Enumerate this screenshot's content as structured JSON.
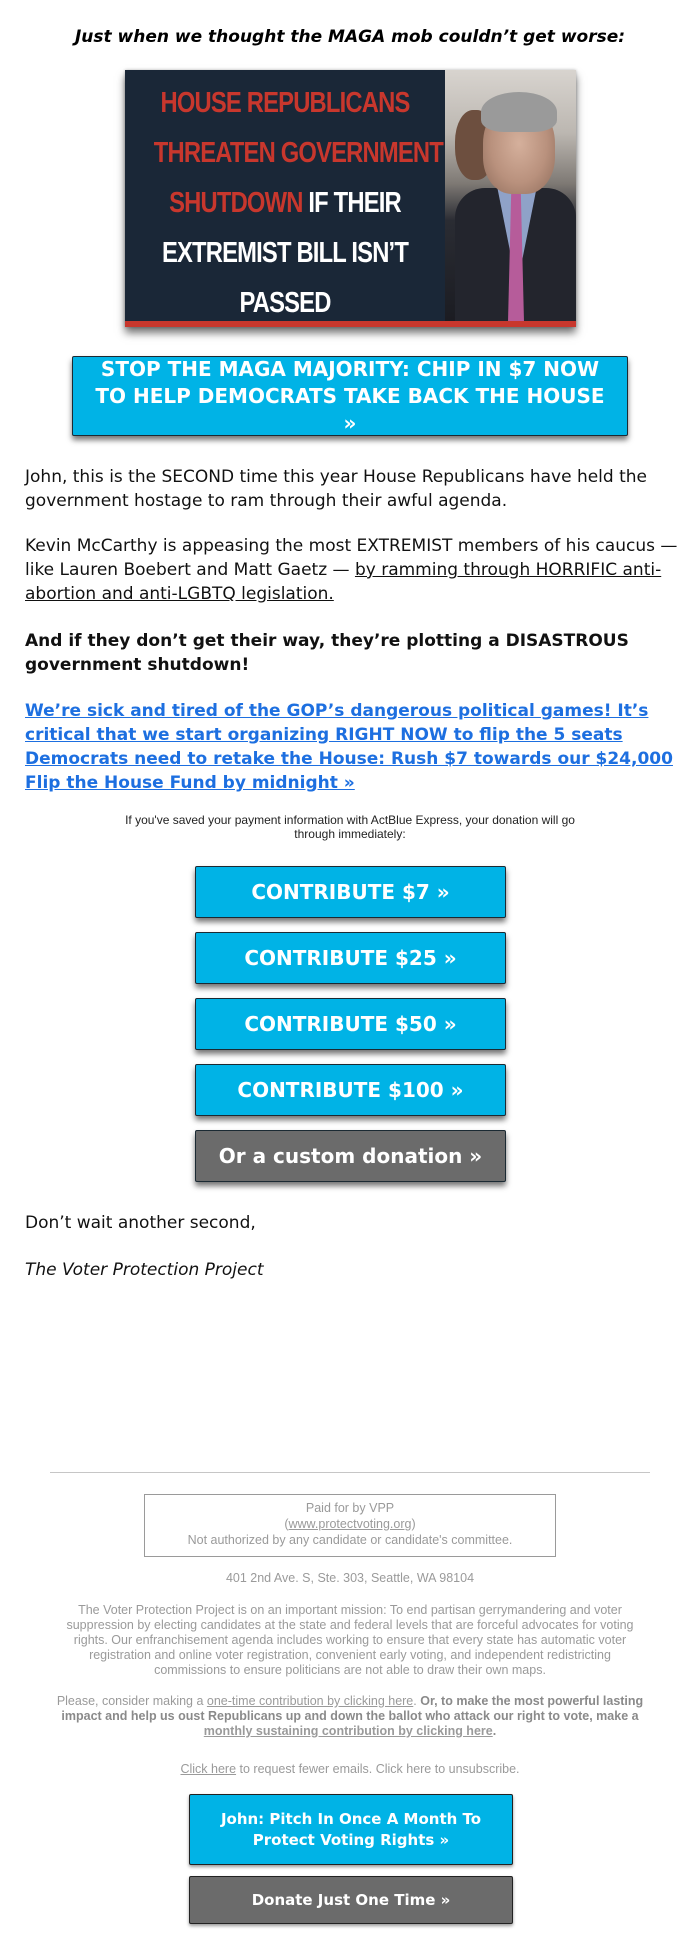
{
  "intro": "Just when we thought the MAGA mob couldn’t get worse:",
  "hero_image": {
    "lines": [
      [
        {
          "text": "HOUSE REPUBLICANS",
          "color": "red"
        }
      ],
      [
        {
          "text": "THREATEN GOVERNMENT",
          "color": "red"
        }
      ],
      [
        {
          "text": "SHUTDOWN",
          "color": "red"
        },
        {
          "text": " IF THEIR",
          "color": "white"
        }
      ],
      [
        {
          "text": "EXTREMIST BILL ISN’T",
          "color": "white"
        }
      ],
      [
        {
          "text": "PASSED",
          "color": "white"
        }
      ]
    ],
    "photo_alt": "Kevin McCarthy photo",
    "colors": {
      "background": "#1a2737",
      "red": "#c8372d",
      "white": "#ffffff"
    }
  },
  "main_cta": "STOP THE MAGA MAJORITY: CHIP IN $7 NOW TO HELP DEMOCRATS TAKE BACK THE HOUSE »",
  "body": {
    "p1": "John, this is the SECOND time this year House Republicans have held the government hostage to ram through their awful agenda.",
    "p2_text": "Kevin McCarthy is appeasing the most EXTREMIST members of his caucus — like Lauren Boebert and Matt Gaetz — ",
    "p2_link": "by ramming through HORRIFIC anti-abortion and anti-LGBTQ legislation.",
    "p3": "And if they don’t get their way, they’re plotting a DISASTROUS government shutdown!",
    "p4_link": "We’re sick and tired of the GOP’s dangerous political games! It’s critical that we start organizing RIGHT NOW to flip the 5 seats Democrats need to retake the House: Rush $7 towards our $24,000 Flip the House Fund by midnight »"
  },
  "express_note": "If you've saved your payment information with ActBlue Express, your donation will go through immediately:",
  "donate_buttons": [
    {
      "label": "CONTRIBUTE $7 »",
      "style": "blue"
    },
    {
      "label": "CONTRIBUTE $25 »",
      "style": "blue"
    },
    {
      "label": "CONTRIBUTE $50 »",
      "style": "blue"
    },
    {
      "label": "CONTRIBUTE $100 »",
      "style": "blue"
    },
    {
      "label": "Or a custom donation »",
      "style": "gray"
    }
  ],
  "closing": "Don’t wait another second,",
  "signature": "The Voter Protection Project",
  "footer": {
    "paid_for": "Paid for by VPP",
    "website_open": "(",
    "website": "www.protectvoting.org",
    "website_close": ")",
    "not_authorized": "Not authorized by any candidate or candidate's committee.",
    "address": "401 2nd Ave. S, Ste. 303, Seattle, WA 98104",
    "mission": "The Voter Protection Project is on an important mission: To end partisan gerrymandering and voter suppression by electing candidates at the state and federal levels that are forceful advocates for voting rights. Our enfranchisement agenda includes working to ensure that every state has automatic voter registration and online voter registration, convenient early voting, and independent redistricting commissions to ensure politicians are not able to draw their own maps.",
    "consider_prefix": "Please, consider making a ",
    "consider_link1": "one-time contribution by clicking here",
    "consider_mid": ". ",
    "consider_bold": "Or, to make the most powerful lasting impact and help us oust Republicans up and down the ballot who attack our right to vote, make a ",
    "consider_link2": "monthly sustaining contribution by clicking here",
    "consider_end": ".",
    "unsub_link": "Click here",
    "unsub_text": " to request fewer emails. Click here to unsubscribe.",
    "monthly_button": "John: Pitch In Once A Month To Protect Voting Rights »",
    "once_button": "Donate Just One Time »"
  },
  "colors": {
    "button_blue": "#00b3e6",
    "button_gray": "#6b6b6b",
    "link_blue": "#1d6fe0",
    "footer_gray": "#9a9a9a"
  }
}
